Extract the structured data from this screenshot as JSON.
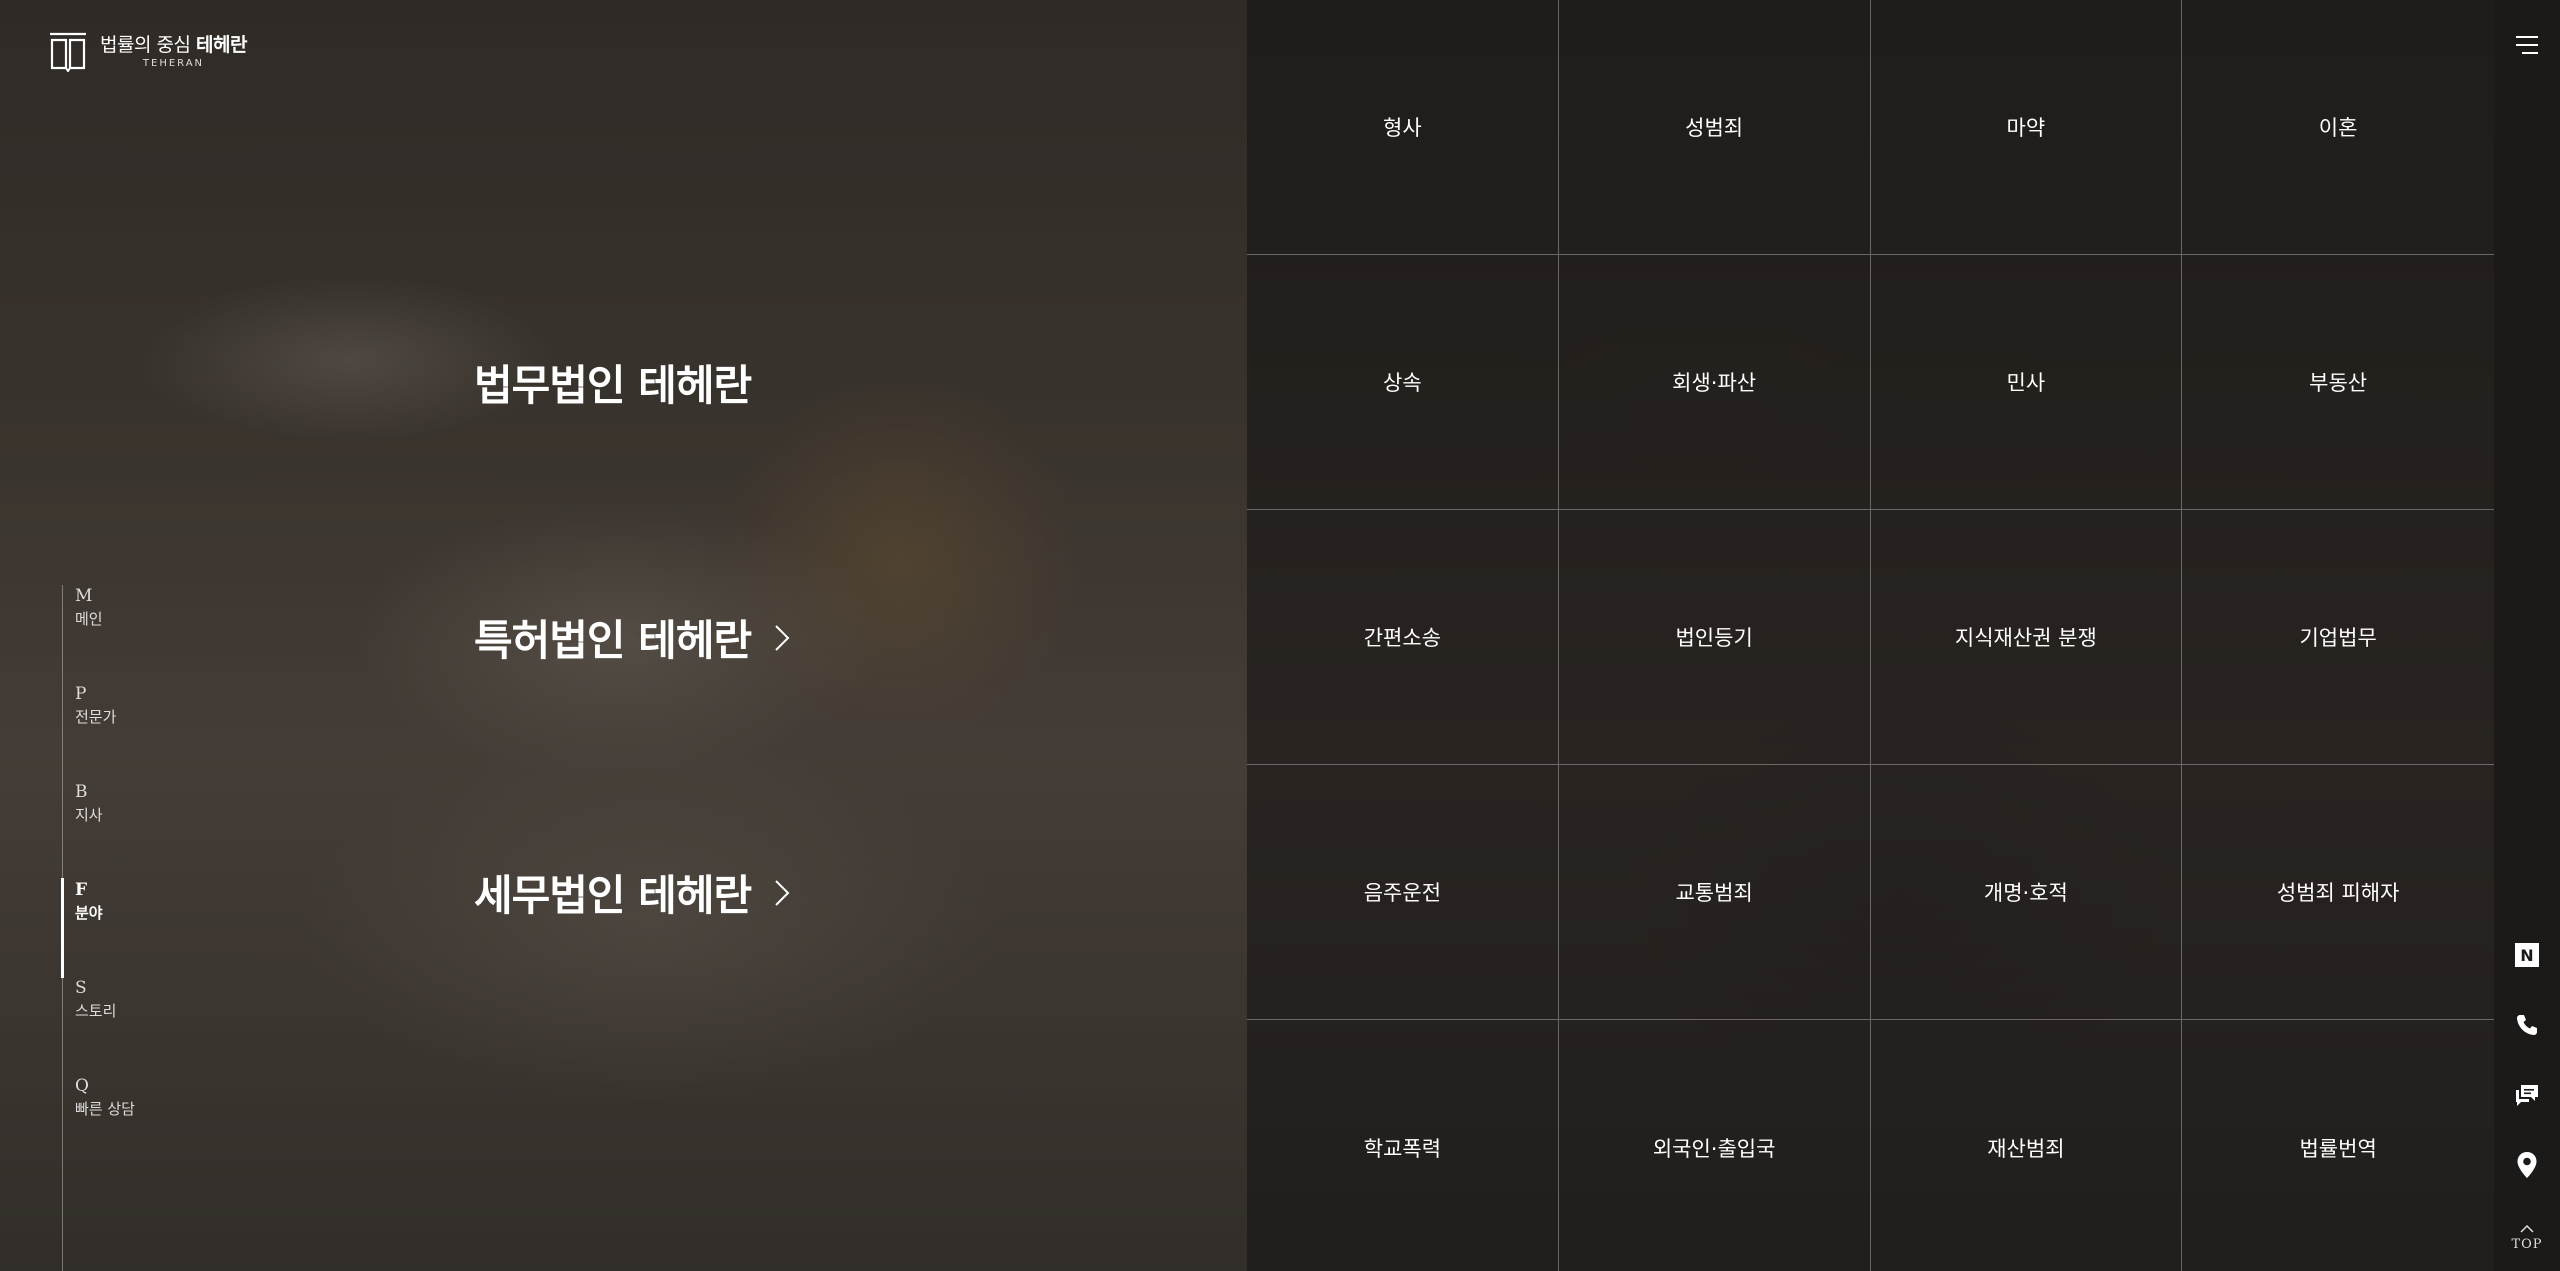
{
  "logo": {
    "main_prefix": "법률의 중심",
    "main_brand": "테헤란",
    "sub": "TEHERAN"
  },
  "side_nav": [
    {
      "letter": "M",
      "label": "메인",
      "active": false
    },
    {
      "letter": "P",
      "label": "전문가",
      "active": false
    },
    {
      "letter": "B",
      "label": "지사",
      "active": false
    },
    {
      "letter": "F",
      "label": "분야",
      "active": true
    },
    {
      "letter": "S",
      "label": "스토리",
      "active": false
    },
    {
      "letter": "Q",
      "label": "빠른 상담",
      "active": false
    }
  ],
  "firms": [
    {
      "title": "법무법인 테헤란"
    },
    {
      "title": "특허법인 테헤란"
    },
    {
      "title": "세무법인 테헤란"
    }
  ],
  "practice_areas": [
    "형사",
    "성범죄",
    "마약",
    "이혼",
    "상속",
    "회생·파산",
    "민사",
    "부동산",
    "간편소송",
    "법인등기",
    "지식재산권 분쟁",
    "기업법무",
    "음주운전",
    "교통범죄",
    "개명·호적",
    "성범죄 피해자",
    "학교폭력",
    "외국인·출입국",
    "재산범죄",
    "법률번역"
  ],
  "quick_links": {
    "naver_letter": "N",
    "top_label": "TOP"
  },
  "icons": {
    "menu": "hamburger-menu-icon",
    "firm_arrow": "chevron-right-icon",
    "naver": "naver-icon",
    "phone": "phone-icon",
    "chat": "chat-icon",
    "location": "location-pin-icon",
    "top": "chevron-up-icon"
  }
}
